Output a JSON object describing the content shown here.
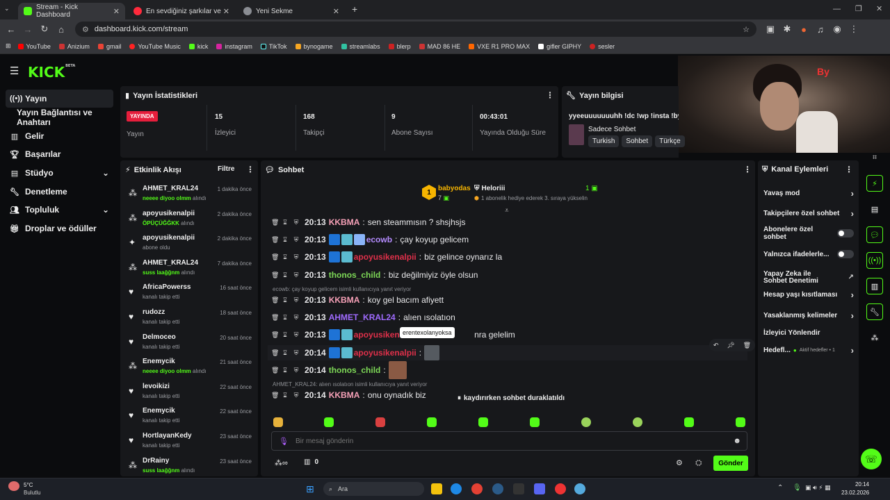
{
  "browser": {
    "tabs": [
      {
        "title": "Stream - Kick Dashboard",
        "active": true
      },
      {
        "title": "En sevdiğiniz şarkılar ve albümle",
        "active": false
      },
      {
        "title": "Yeni Sekme",
        "active": false
      }
    ],
    "url": "dashboard.kick.com/stream",
    "bookmarks": [
      "YouTube",
      "Anizium",
      "gmail",
      "YouTube Music",
      "kick",
      "instagram",
      "TikTok",
      "bynogame",
      "streamlabs",
      "blerp",
      "MAD 86 HE",
      "VXE R1 PRO MAX",
      "gifler GIPHY",
      "sesler"
    ]
  },
  "kick": {
    "logo": "KICK",
    "logo_sup": "BETA"
  },
  "sidebar": {
    "items": [
      {
        "label": "Yayın",
        "icon": "broadcast-icon",
        "active": true
      },
      {
        "label": "Yayın Bağlantısı ve Anahtarı",
        "icon": "",
        "active": false
      },
      {
        "label": "Gelir",
        "icon": "revenue-icon",
        "active": false
      },
      {
        "label": "Başarılar",
        "icon": "trophy-icon",
        "active": false
      },
      {
        "label": "Stüdyo",
        "icon": "studio-icon",
        "active": false
      },
      {
        "label": "Denetleme",
        "icon": "wrench-icon",
        "active": false
      },
      {
        "label": "Topluluk",
        "icon": "community-icon",
        "active": false
      },
      {
        "label": "Droplar ve ödüller",
        "icon": "gift-icon",
        "active": false
      }
    ]
  },
  "stats": {
    "title": "Yayın İstatistikleri",
    "live_badge": "YAYINDA",
    "live_label": "Yayın",
    "items": [
      {
        "value": "15",
        "label": "İzleyici"
      },
      {
        "value": "168",
        "label": "Takipçi"
      },
      {
        "value": "9",
        "label": "Abone Sayısı"
      },
      {
        "value": "00:43:01",
        "label": "Yayında Olduğu Süre"
      }
    ]
  },
  "stream_info": {
    "title": "Yayın bilgisi",
    "stream_title": "yyeeuuuuuuuhh !dc !wp !insta !byn",
    "category": "Sadece Sohbet",
    "tags": [
      "Turkish",
      "Sohbet",
      "Türkçe"
    ]
  },
  "activity": {
    "title": "Etkinlik Akışı",
    "filter": "Filtre",
    "items": [
      {
        "name": "AHMET_KRAL24",
        "sub_green": "neeee diyoo olmm",
        "sub": "alındı",
        "time": "1 dakika önce",
        "icon": "kicks"
      },
      {
        "name": "apoyusikenalpii",
        "sub_green": "ÖPÜÇÜĞĞKK",
        "sub": "alındı",
        "time": "2 dakika önce",
        "icon": "kicks"
      },
      {
        "name": "apoyusikenalpii",
        "sub_green": "",
        "sub": "abone oldu",
        "time": "2 dakika önce",
        "icon": "sub"
      },
      {
        "name": "AHMET_KRAL24",
        "sub_green": "suss laağğnm",
        "sub": "alındı",
        "time": "7 dakika önce",
        "icon": "kicks"
      },
      {
        "name": "AfricaPowerss",
        "sub_green": "",
        "sub": "kanalı takip etti",
        "time": "16 saat önce",
        "icon": "heart"
      },
      {
        "name": "rudozz",
        "sub_green": "",
        "sub": "kanalı takip etti",
        "time": "18 saat önce",
        "icon": "heart"
      },
      {
        "name": "Delmoceo",
        "sub_green": "",
        "sub": "kanalı takip etti",
        "time": "20 saat önce",
        "icon": "heart"
      },
      {
        "name": "Enemycik",
        "sub_green": "neeee diyoo olmm",
        "sub": "alındı",
        "time": "21 saat önce",
        "icon": "kicks"
      },
      {
        "name": "levoikizi",
        "sub_green": "",
        "sub": "kanalı takip etti",
        "time": "22 saat önce",
        "icon": "heart"
      },
      {
        "name": "Enemycik",
        "sub_green": "",
        "sub": "kanalı takip etti",
        "time": "22 saat önce",
        "icon": "heart"
      },
      {
        "name": "HortlayanKedy",
        "sub_green": "",
        "sub": "kanalı takip etti",
        "time": "23 saat önce",
        "icon": "heart"
      },
      {
        "name": "DrRainy",
        "sub_green": "suss laağğnm",
        "sub": "alındı",
        "time": "23 saat önce",
        "icon": "kicks"
      }
    ]
  },
  "chat": {
    "title": "Sohbet",
    "leaderboard": {
      "first_name": "babyodas",
      "first_count": "7",
      "second_name": "Heloriii",
      "second_count": "1",
      "second_sub": "1 abonelik hediye ederek 3. sıraya yükselin"
    },
    "messages": [
      {
        "time": "20:13",
        "user": "KKBMA",
        "color": "#f7a1b8",
        "text": "sen steammısın ? shsjhsjs",
        "badges": 0
      },
      {
        "time": "20:13",
        "user": "ecowb",
        "color": "#b58cff",
        "text": "çay koyup gelicem",
        "badges": 3
      },
      {
        "time": "20:13",
        "user": "apoyusikenalpii",
        "color": "#e0304a",
        "text": "biz gelince oynarız la",
        "badges": 2
      },
      {
        "time": "20:13",
        "user": "thonos_child",
        "color": "#7ed957",
        "text": "biz değilmiyiz öyle olsun",
        "badges": 0
      },
      {
        "time": "20:13",
        "user": "KKBMA",
        "color": "#f7a1b8",
        "text": "koy gel bacım afiyett",
        "badges": 0,
        "reply": "ecowb: çay koyup gelicem isimli kullanıcıya yanıt veriyor"
      },
      {
        "time": "20:13",
        "user": "AHMET_KRAL24",
        "color": "#a06bff",
        "text": "alıen ısolatıon",
        "badges": 0
      },
      {
        "time": "20:13",
        "user": "apoyusiken",
        "color": "#e0304a",
        "text": "nra gelelim",
        "badges": 2
      },
      {
        "time": "20:14",
        "user": "apoyusikenalpii",
        "color": "#e0304a",
        "text": "",
        "badges": 2
      },
      {
        "time": "20:14",
        "user": "thonos_child",
        "color": "#7ed957",
        "text": "",
        "badges": 0
      },
      {
        "time": "20:14",
        "user": "KKBMA",
        "color": "#f7a1b8",
        "text": "onu oynadık biz",
        "badges": 0,
        "reply": "AHMET_KRAL24: alıen ısolatıon isimli kullanıcıya yanıt veriyor"
      }
    ],
    "tooltip": "erentexolanyoksa",
    "paused": "kaydırırken sohbet duraklatıldı",
    "input_placeholder": "Bir mesaj gönderin",
    "kicks_count": "0",
    "send_label": "Gönder"
  },
  "channel_actions": {
    "title": "Kanal Eylemleri",
    "items": [
      {
        "label": "Yavaş mod",
        "control": "arrow"
      },
      {
        "label": "Takipçilere özel sohbet",
        "control": "arrow"
      },
      {
        "label": "Abonelere özel sohbet",
        "control": "toggle"
      },
      {
        "label": "Yalnızca ifadelerle...",
        "control": "toggle"
      },
      {
        "label": "Yapay Zeka ile Sohbet Denetimi",
        "control": "external"
      },
      {
        "label": "Hesap yaşı kısıtlaması",
        "control": "arrow"
      },
      {
        "label": "Yasaklanmış kelimeler",
        "control": "arrow"
      },
      {
        "label": "İzleyici Yönlendir",
        "control": "none"
      },
      {
        "label": "Hedefl...",
        "control": "arrow",
        "extra": "Aktif hedefler • 1"
      }
    ]
  },
  "taskbar": {
    "weather_temp": "5°C",
    "weather_text": "Bulutlu",
    "search": "Ara",
    "time": "20:14",
    "date": "23.02.2026"
  },
  "colors": {
    "accent": "#53fc18",
    "live": "#e61e3c",
    "bg": "#0b0c0e",
    "panel": "#17181b"
  }
}
